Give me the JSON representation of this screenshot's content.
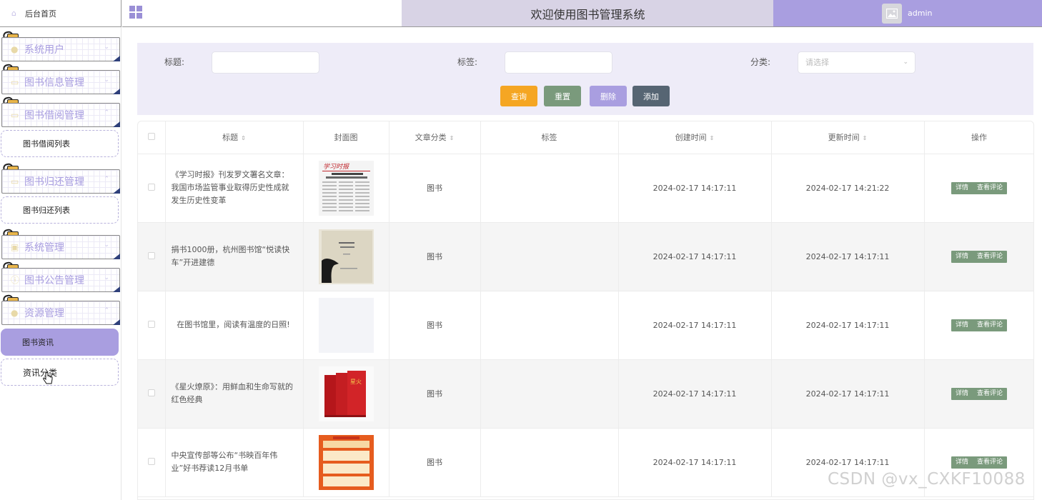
{
  "sidebar": {
    "home": "后台首页",
    "menus": [
      {
        "label": "系统用户",
        "icon": "user-icon"
      },
      {
        "label": "图书信息管理",
        "icon": "folder-icon"
      },
      {
        "label": "图书借阅管理",
        "icon": "folder-icon"
      },
      {
        "label": "图书归还管理",
        "icon": "folder-icon"
      },
      {
        "label": "系统管理",
        "icon": "image-icon"
      },
      {
        "label": "图书公告管理",
        "icon": "info-icon"
      },
      {
        "label": "资源管理",
        "icon": "lightbulb-icon"
      }
    ],
    "subs": {
      "borrow_list": "图书借阅列表",
      "return_list": "图书归还列表",
      "book_news": "图书资讯",
      "news_category": "资讯分类"
    }
  },
  "header": {
    "title": "欢迎使用图书管理系统",
    "user": "admin"
  },
  "search": {
    "title_label": "标题:",
    "tag_label": "标签:",
    "category_label": "分类:",
    "category_placeholder": "请选择",
    "buttons": {
      "query": "查询",
      "reset": "重置",
      "delete": "删除",
      "add": "添加"
    },
    "button_colors": {
      "query": "#f5a623",
      "reset": "#7a9a7c",
      "delete": "#a99ee0",
      "add": "#566573"
    }
  },
  "table": {
    "headers": {
      "title": "标题",
      "cover": "封面图",
      "category": "文章分类",
      "tags": "标签",
      "created": "创建时间",
      "updated": "更新时间",
      "actions": "操作"
    },
    "action_labels": {
      "detail": "详情",
      "comments": "查看评论"
    },
    "rows": [
      {
        "title": "《学习时报》刊发罗文署名文章：我国市场监管事业取得历史性成就发生历史性变革",
        "category": "图书",
        "tags": "",
        "created": "2024-02-17 14:17:11",
        "updated": "2024-02-17 14:21:22",
        "cover": "newspaper"
      },
      {
        "title": "捐书1000册，杭州图书馆“悦读快车”开进建德",
        "category": "图书",
        "tags": "",
        "created": "2024-02-17 14:17:11",
        "updated": "2024-02-17 14:17:11",
        "cover": "book-cover"
      },
      {
        "title": "在图书馆里，阅读有温度的日照!",
        "category": "图书",
        "tags": "",
        "created": "2024-02-17 14:17:11",
        "updated": "2024-02-17 14:17:11",
        "cover": "blank"
      },
      {
        "title": "《星火燎原》：用鲜血和生命写就的红色经典",
        "category": "图书",
        "tags": "",
        "created": "2024-02-17 14:17:11",
        "updated": "2024-02-17 14:17:11",
        "cover": "red-books"
      },
      {
        "title": "中央宣传部等公布“书映百年伟业”好书荐读12月书单",
        "category": "图书",
        "tags": "",
        "created": "2024-02-17 14:17:11",
        "updated": "2024-02-17 14:17:11",
        "cover": "orange-poster"
      }
    ]
  },
  "watermark": "CSDN @vx_CXKF10088"
}
